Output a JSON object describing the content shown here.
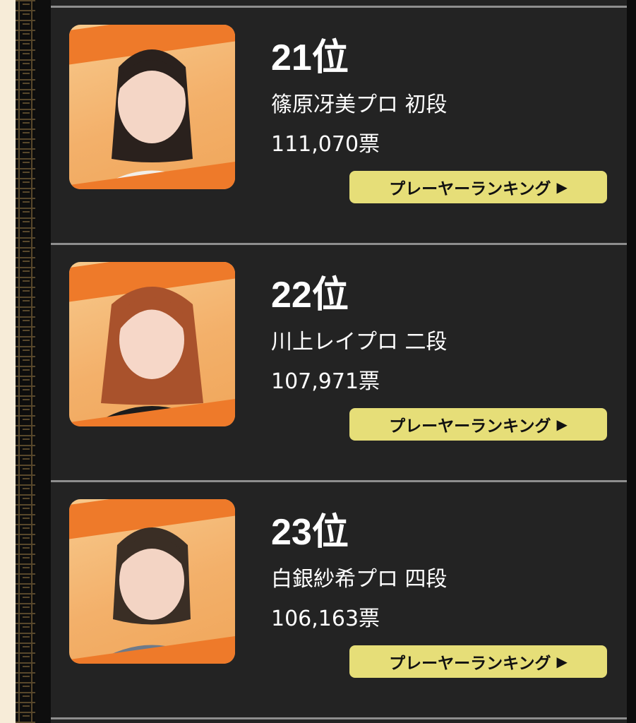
{
  "players": [
    {
      "rank": "21位",
      "name": "篠原冴美プロ 初段",
      "votes": "111,070票",
      "button_label": "プレーヤーランキング",
      "button_icon": "play-arrow-icon",
      "photo": {
        "hair": "#2a211d",
        "skin": "#f4d6c6",
        "outfit": "#f2eee8"
      }
    },
    {
      "rank": "22位",
      "name": "川上レイプロ 二段",
      "votes": "107,971票",
      "button_label": "プレーヤーランキング",
      "button_icon": "play-arrow-icon",
      "photo": {
        "hair": "#a9522c",
        "skin": "#f6d7c8",
        "outfit": "#1c1c1c"
      }
    },
    {
      "rank": "23位",
      "name": "白銀紗希プロ 四段",
      "votes": "106,163票",
      "button_label": "プレーヤーランキング",
      "button_icon": "play-arrow-icon",
      "photo": {
        "hair": "#3a2e25",
        "skin": "#f3d4c4",
        "outfit": "#6d7a8a"
      }
    }
  ],
  "colors": {
    "background": "#232323",
    "button": "#e6de78",
    "accent_orange": "#ee7a2a",
    "divider": "#8e8e8e"
  }
}
